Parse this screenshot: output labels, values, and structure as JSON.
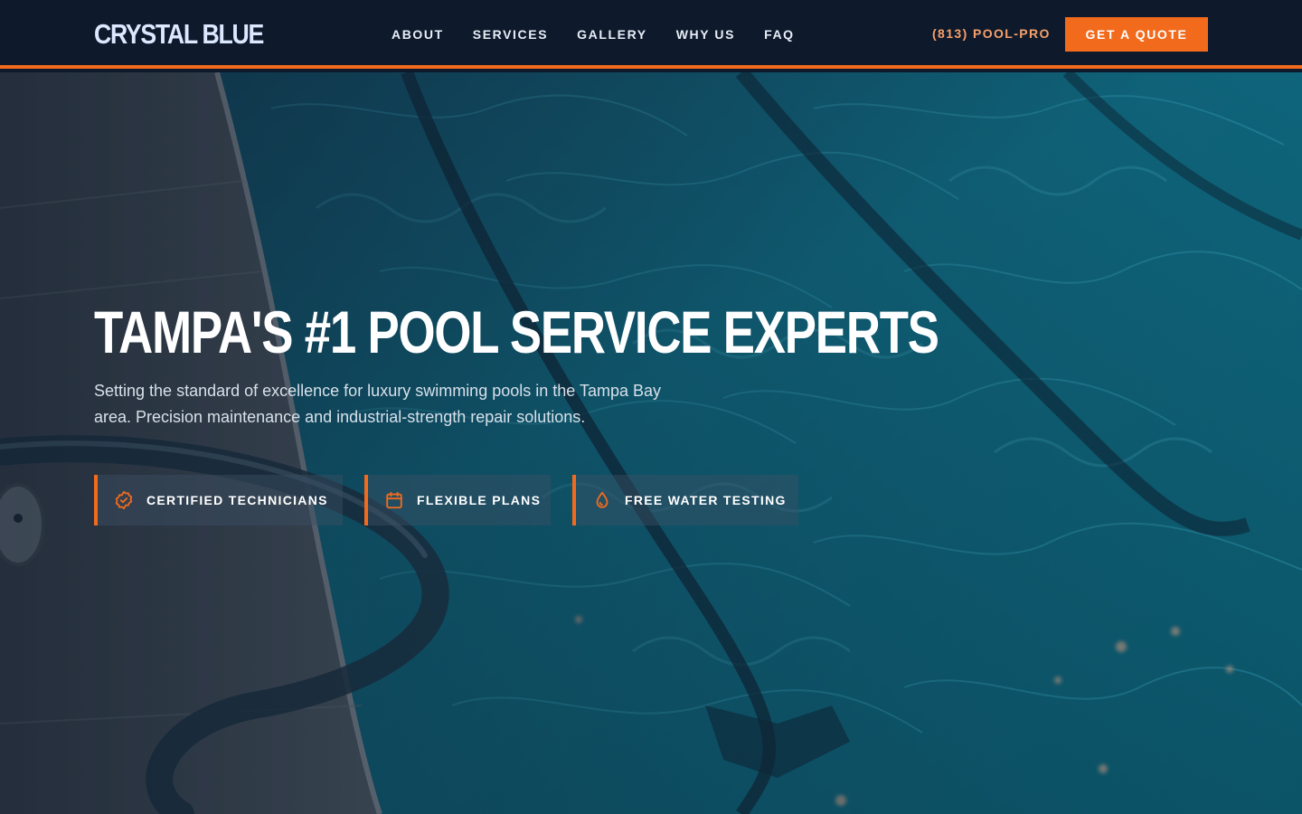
{
  "brand": {
    "name": "CRYSTAL BLUE"
  },
  "nav": {
    "items": [
      {
        "label": "ABOUT"
      },
      {
        "label": "SERVICES"
      },
      {
        "label": "GALLERY"
      },
      {
        "label": "WHY US"
      },
      {
        "label": "FAQ"
      }
    ]
  },
  "header": {
    "phone": "(813) POOL-PRO",
    "cta_label": "GET A QUOTE"
  },
  "hero": {
    "title": "TAMPA'S #1 POOL SERVICE EXPERTS",
    "subtitle_line1": "Setting the standard of excellence for luxury swimming pools in the Tampa Bay",
    "subtitle_line2": "area. Precision maintenance and industrial-strength repair solutions.",
    "features": [
      {
        "label": "CERTIFIED TECHNICIANS",
        "icon": "badge-check-icon"
      },
      {
        "label": "FLEXIBLE PLANS",
        "icon": "calendar-icon"
      },
      {
        "label": "FREE WATER TESTING",
        "icon": "droplet-icon"
      }
    ]
  },
  "colors": {
    "accent": "#f26b1d",
    "header_bg": "#0e1a2b",
    "water": "#0f6f86"
  }
}
